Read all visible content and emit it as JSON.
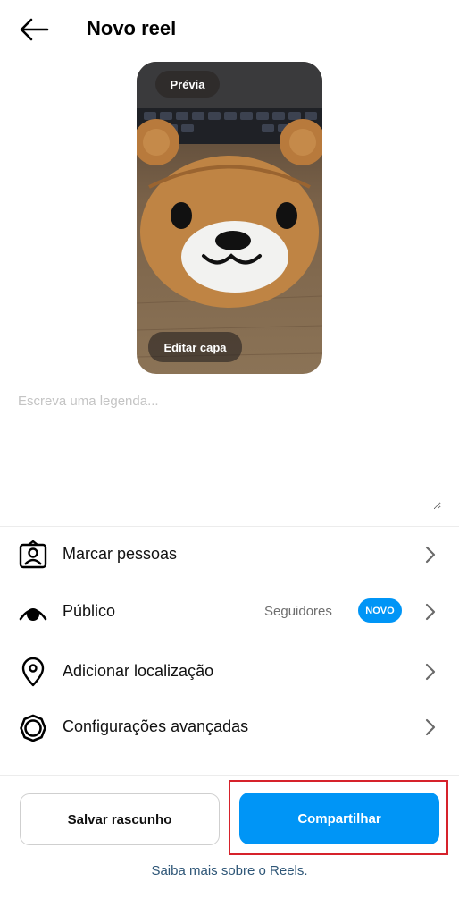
{
  "header": {
    "title": "Novo reel"
  },
  "preview": {
    "preview_label": "Prévia",
    "edit_cover_label": "Editar capa"
  },
  "caption": {
    "placeholder": "Escreva uma legenda..."
  },
  "menu": {
    "items": [
      {
        "label": "Marcar pessoas",
        "icon": "tag-people-icon"
      },
      {
        "label": "Público",
        "icon": "eye-icon",
        "value": "Seguidores",
        "badge": "NOVO"
      },
      {
        "label": "Adicionar localização",
        "icon": "location-pin-icon"
      },
      {
        "label": "Configurações avançadas",
        "icon": "gear-icon"
      }
    ]
  },
  "actions": {
    "save_draft_label": "Salvar rascunho",
    "share_label": "Compartilhar"
  },
  "footer": {
    "learn_more": "Saiba mais sobre o Reels."
  },
  "colors": {
    "accent": "#0095f6",
    "highlight_outline": "#d6222b",
    "link": "#2e5677"
  }
}
